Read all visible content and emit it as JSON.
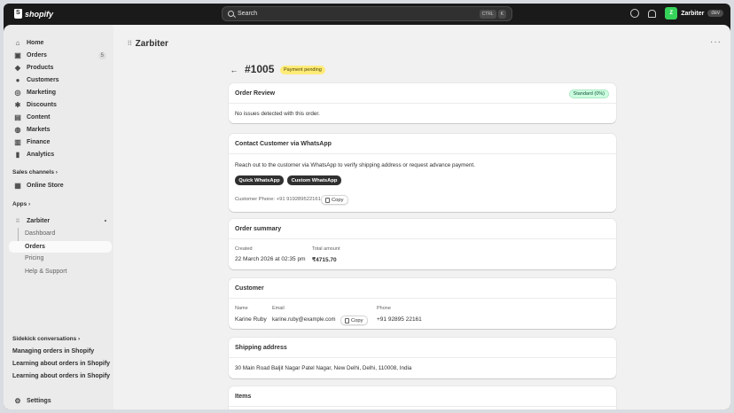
{
  "topbar": {
    "logo_text": "shopify",
    "search_placeholder": "Search",
    "kbd_ctrl": "CTRL",
    "kbd_key": "K",
    "store_initial": "Z",
    "store_name": "Zarbiter",
    "store_badge": "dev"
  },
  "sidebar": {
    "items": [
      {
        "label": "Home",
        "icon": "home-icon"
      },
      {
        "label": "Orders",
        "icon": "inbox-icon",
        "count": "5"
      },
      {
        "label": "Products",
        "icon": "tag-icon"
      },
      {
        "label": "Customers",
        "icon": "person-icon"
      },
      {
        "label": "Marketing",
        "icon": "target-icon"
      },
      {
        "label": "Discounts",
        "icon": "discount-icon"
      },
      {
        "label": "Content",
        "icon": "content-icon"
      },
      {
        "label": "Markets",
        "icon": "globe-icon"
      },
      {
        "label": "Finance",
        "icon": "bank-icon"
      },
      {
        "label": "Analytics",
        "icon": "bar-chart-icon"
      }
    ],
    "sales_channels_label": "Sales channels ›",
    "online_store_label": "Online Store",
    "apps_label": "Apps ›",
    "app_name": "Zarbiter",
    "app_subitems": [
      "Dashboard",
      "Orders",
      "Pricing",
      "Help & Support"
    ],
    "sidekick_label": "Sidekick conversations ›",
    "sidekick_items": [
      "Managing orders in Shopify",
      "Learning about orders in Shopify",
      "Learning about orders in Shopify"
    ],
    "settings_label": "Settings"
  },
  "main": {
    "page_title": "Zarbiter",
    "order_id": "#1005",
    "payment_status": "Payment pending",
    "order_review": {
      "title": "Order Review",
      "badge": "Standard (0%)",
      "message": "No issues detected with this order."
    },
    "whatsapp": {
      "title": "Contact Customer via WhatsApp",
      "description": "Reach out to the customer via WhatsApp to verify shipping address or request advance payment.",
      "quick_button": "Quick WhatsApp",
      "custom_button": "Custom WhatsApp",
      "phone_line": "Customer Phone: +91 919289522161",
      "copy_label": "Copy"
    },
    "order_summary": {
      "title": "Order summary",
      "created_label": "Created",
      "created_value": "22 March 2026 at 02:35 pm",
      "total_label": "Total amount",
      "total_value": "₹4715.70"
    },
    "customer": {
      "title": "Customer",
      "name_label": "Name",
      "name_value": "Karine Ruby",
      "email_label": "Email",
      "email_value": "karine.ruby@example.com",
      "copy_label": "Copy",
      "phone_label": "Phone",
      "phone_value": "+91 92895 22161"
    },
    "shipping": {
      "title": "Shipping address",
      "address": "30 Main Road Baljit Nagar Patel Nagar, New Delhi, Delhi, 110008, India"
    },
    "items": {
      "title": "Items"
    }
  },
  "colors": {
    "topbar_bg": "#1a1a1a",
    "sidebar_bg": "#ebebeb",
    "main_bg": "#f1f1f1",
    "payment_badge_bg": "#ffeb78",
    "standard_badge_bg": "#cdfee1",
    "store_badge_bg": "#36d35a",
    "primary_button_bg": "#303030"
  }
}
